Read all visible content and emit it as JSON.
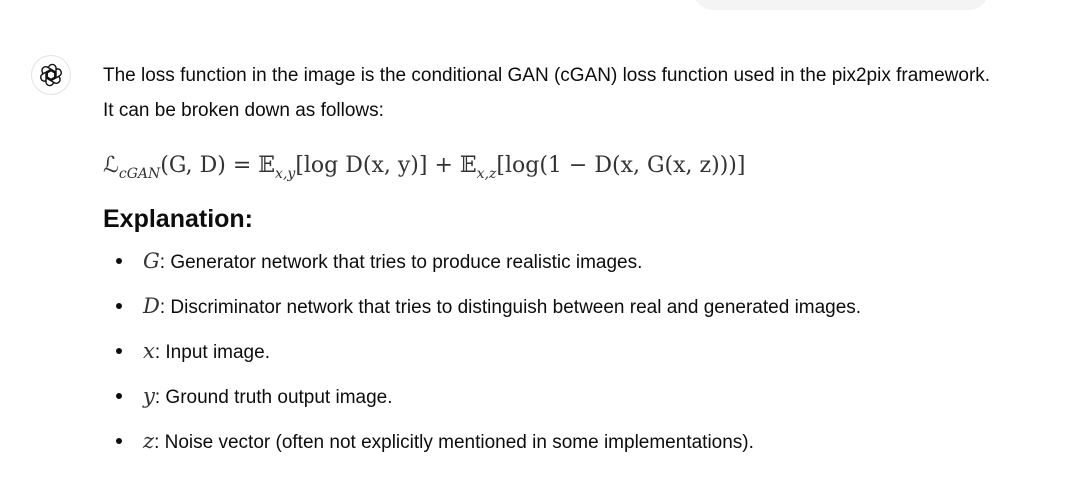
{
  "assistant": {
    "avatar_icon": "openai-logo-icon"
  },
  "message": {
    "intro": "The loss function in the image is the conditional GAN (cGAN) loss function used in the pix2pix framework. It can be broken down as follows:",
    "formula": {
      "L": "ℒ",
      "L_sub": "cGAN",
      "args": "(G, D) = ",
      "E1": "𝔼",
      "E1_sub": "x,y",
      "term1": "[log D(x, y)] + ",
      "E2": "𝔼",
      "E2_sub": "x,z",
      "term2": "[log(1 − D(x, G(x, z)))]"
    },
    "heading": "Explanation:",
    "bullets": [
      {
        "symbol": "G",
        "text": ": Generator network that tries to produce realistic images."
      },
      {
        "symbol": "D",
        "text": ": Discriminator network that tries to distinguish between real and generated images."
      },
      {
        "symbol": "x",
        "text": ": Input image."
      },
      {
        "symbol": "y",
        "text": ": Ground truth output image."
      },
      {
        "symbol": "z",
        "text": ": Noise vector (often not explicitly mentioned in some implementations)."
      }
    ]
  }
}
